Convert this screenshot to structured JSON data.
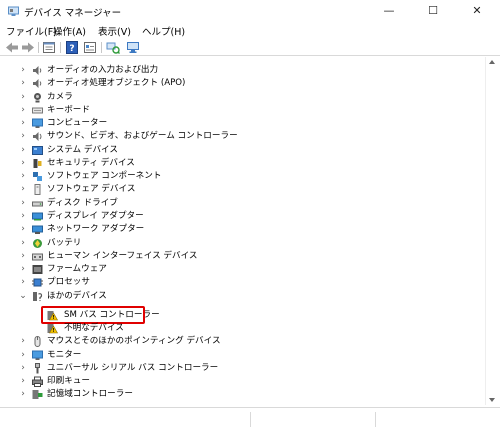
{
  "window": {
    "title": "デバイス マネージャー",
    "controls": {
      "minimize": "—",
      "maximize": "☐",
      "close": "✕"
    }
  },
  "menu": [
    {
      "label": "ファイル(F)"
    },
    {
      "label": "操作(A)"
    },
    {
      "label": "表示(V)"
    },
    {
      "label": "ヘルプ(H)"
    }
  ],
  "toolbar": {
    "buttons": [
      "back-icon",
      "forward-icon",
      "properties-icon",
      "help-icon",
      "view-icon",
      "scan-hardware-icon",
      "monitor-icon"
    ]
  },
  "tree": {
    "items": [
      {
        "label": "オーディオの入力および出力",
        "icon": "speaker-icon",
        "expanded": false
      },
      {
        "label": "オーディオ処理オブジェクト (APO)",
        "icon": "speaker-icon",
        "expanded": false
      },
      {
        "label": "カメラ",
        "icon": "camera-icon",
        "expanded": false
      },
      {
        "label": "キーボード",
        "icon": "keyboard-icon",
        "expanded": false
      },
      {
        "label": "コンピューター",
        "icon": "computer-icon",
        "expanded": false
      },
      {
        "label": "サウンド、ビデオ、およびゲーム コントローラー",
        "icon": "sound-icon",
        "expanded": false
      },
      {
        "label": "システム デバイス",
        "icon": "system-device-icon",
        "expanded": false
      },
      {
        "label": "セキュリティ デバイス",
        "icon": "security-device-icon",
        "expanded": false
      },
      {
        "label": "ソフトウェア コンポーネント",
        "icon": "software-component-icon",
        "expanded": false
      },
      {
        "label": "ソフトウェア デバイス",
        "icon": "software-device-icon",
        "expanded": false
      },
      {
        "label": "ディスク ドライブ",
        "icon": "disk-drive-icon",
        "expanded": false
      },
      {
        "label": "ディスプレイ アダプター",
        "icon": "display-adapter-icon",
        "expanded": false
      },
      {
        "label": "ネットワーク アダプター",
        "icon": "network-adapter-icon",
        "expanded": false
      },
      {
        "label": "バッテリ",
        "icon": "battery-icon",
        "expanded": false
      },
      {
        "label": "ヒューマン インターフェイス デバイス",
        "icon": "hid-icon",
        "expanded": false
      },
      {
        "label": "ファームウェア",
        "icon": "firmware-icon",
        "expanded": false
      },
      {
        "label": "プロセッサ",
        "icon": "processor-icon",
        "expanded": false
      },
      {
        "label": "ほかのデバイス",
        "icon": "other-devices-icon",
        "expanded": true
      },
      {
        "label": "SM バス コントローラー",
        "icon": "warning-icon",
        "child": true,
        "selected": true
      },
      {
        "label": "不明なデバイス",
        "icon": "warning-icon",
        "child": true
      },
      {
        "label": "マウスとそのほかのポインティング デバイス",
        "icon": "mouse-icon",
        "expanded": false
      },
      {
        "label": "モニター",
        "icon": "monitor-icon",
        "expanded": false
      },
      {
        "label": "ユニバーサル シリアル バス コントローラー",
        "icon": "usb-icon",
        "expanded": false
      },
      {
        "label": "印刷キュー",
        "icon": "printer-icon",
        "expanded": false
      },
      {
        "label": "記憶域コントローラー",
        "icon": "storage-controller-icon",
        "expanded": false
      }
    ]
  },
  "colors": {
    "highlight": "#e00000",
    "warning": "#f2c200",
    "accent": "#2d7dd2"
  }
}
